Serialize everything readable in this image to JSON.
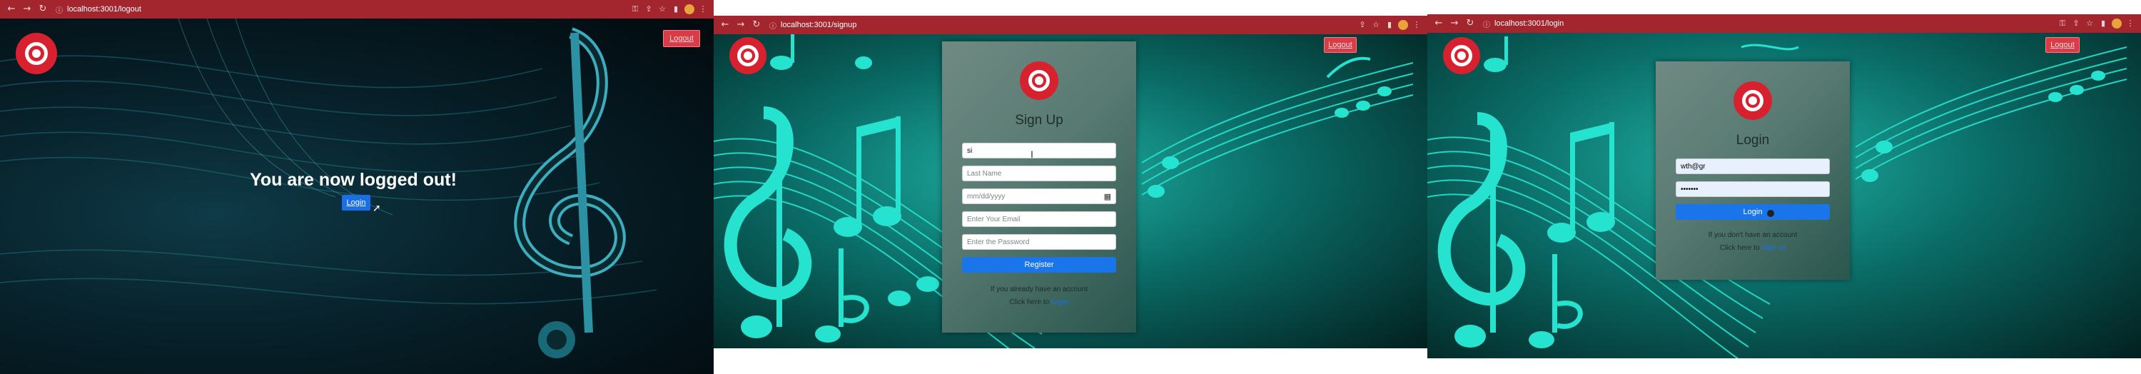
{
  "window1": {
    "address": "localhost:3001/logout",
    "logout_label": "Logout",
    "heading": "You are now logged out!",
    "login_button": "Login"
  },
  "window2": {
    "address": "localhost:3001/signup",
    "logout_label": "Logout",
    "title": "Sign Up",
    "first_name_value": "si",
    "last_name_placeholder": "Last Name",
    "dob_placeholder": "mm/dd/yyyy",
    "email_placeholder": "Enter Your Email",
    "password_placeholder": "Enter the Password",
    "register_button": "Register",
    "note1": "If you already have an account",
    "note2_prefix": "Click here to",
    "note2_link": "Login"
  },
  "window3": {
    "address": "localhost:3001/login",
    "logout_label": "Logout",
    "title": "Login",
    "email_value": "wth@gr",
    "password_value": "•••••••",
    "login_button": "Login",
    "note1": "If you don't have an account",
    "note2_prefix": "Click here to",
    "note2_link": "Sign up"
  },
  "icons": {
    "back": "arrow-left-icon",
    "forward": "arrow-right-icon",
    "reload": "reload-icon",
    "lock": "site-info-icon",
    "bookmark": "star-icon",
    "menu": "kebab-menu-icon"
  },
  "colors": {
    "chrome": "#a3262f",
    "brand_red": "#d7212f",
    "teal": "#25e3cf",
    "button_blue": "#1a74ea"
  }
}
